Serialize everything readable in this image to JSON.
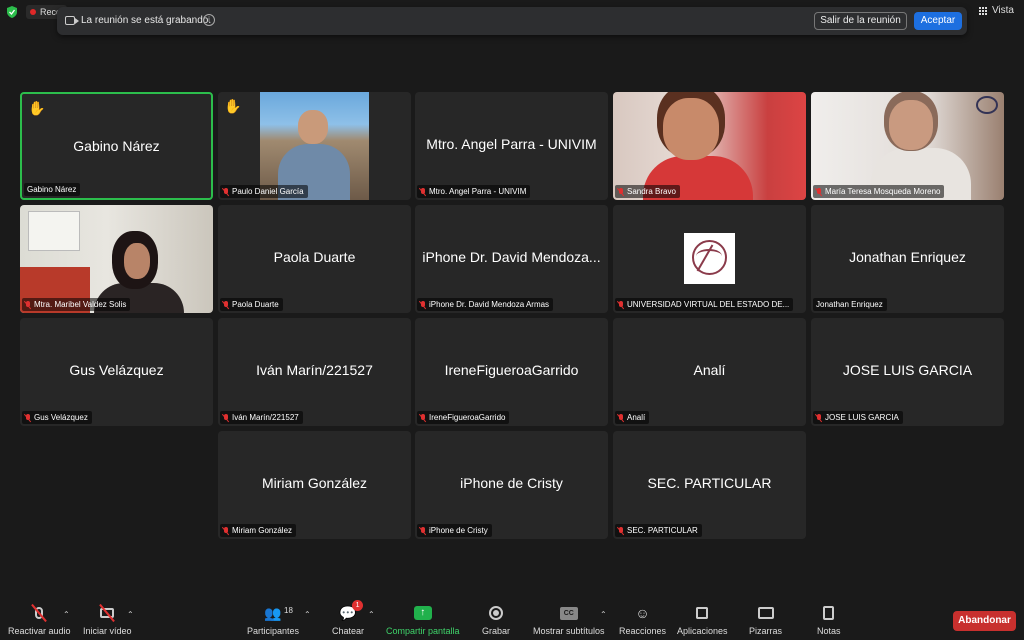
{
  "topbar": {
    "rec_label": "Reco",
    "view_label": "Vista"
  },
  "banner": {
    "message": "La reunión se está grabando.",
    "leave_label": "Salir de la reunión",
    "accept_label": "Aceptar"
  },
  "participants": [
    {
      "display": "Gabino Nárez",
      "label": "Gabino Nárez",
      "muted": false,
      "hand": true,
      "active": true
    },
    {
      "display": "",
      "label": "Paulo Daniel García",
      "muted": true,
      "hand": true,
      "video": "paulo"
    },
    {
      "display": "Mtro. Angel Parra - UNIVIM",
      "label": "Mtro. Angel Parra - UNIVIM",
      "muted": true
    },
    {
      "display": "",
      "label": "Sandra Bravo",
      "muted": true,
      "video": "sandra"
    },
    {
      "display": "",
      "label": "María Teresa Mosqueda Moreno",
      "muted": true,
      "video": "maria"
    },
    {
      "display": "",
      "label": "Mtra. Maribel Valdez Solis",
      "muted": true,
      "video": "maribel"
    },
    {
      "display": "Paola Duarte",
      "label": "Paola Duarte",
      "muted": true
    },
    {
      "display": "iPhone Dr. David Mendoza...",
      "label": "iPhone Dr. David Mendoza Armas",
      "muted": true
    },
    {
      "display": "",
      "label": "UNIVERSIDAD VIRTUAL DEL ESTADO DE...",
      "muted": true,
      "video": "univim-logo"
    },
    {
      "display": "Jonathan Enriquez",
      "label": "Jonathan Enriquez",
      "muted": false
    },
    {
      "display": "Gus Velázquez",
      "label": "Gus Velázquez",
      "muted": true
    },
    {
      "display": "Iván Marín/221527",
      "label": "Iván Marín/221527",
      "muted": true
    },
    {
      "display": "IreneFigueroaGarrido",
      "label": "IreneFigueroaGarrido",
      "muted": true
    },
    {
      "display": "Analí",
      "label": "Analí",
      "muted": true
    },
    {
      "display": "JOSE LUIS GARCIA",
      "label": "JOSE LUIS GARCIA",
      "muted": true
    },
    {
      "display": "Miriam González",
      "label": "Miriam González",
      "muted": true
    },
    {
      "display": "iPhone de Cristy",
      "label": "iPhone de Cristy",
      "muted": true
    },
    {
      "display": "SEC. PARTICULAR",
      "label": "SEC. PARTICULAR",
      "muted": true
    }
  ],
  "toolbar": {
    "unmute": "Reactivar audio",
    "start_video": "Iniciar vídeo",
    "participants": "Participantes",
    "participants_count": "18",
    "chat": "Chatear",
    "chat_badge": "1",
    "share": "Compartir pantalla",
    "record": "Grabar",
    "subtitles": "Mostrar subtítulos",
    "cc": "CC",
    "reactions": "Reacciones",
    "apps": "Aplicaciones",
    "whiteboards": "Pizarras",
    "notes": "Notas",
    "leave": "Abandonar"
  },
  "colors": {
    "active_speaker": "#2cbe4c",
    "leave_button": "#c8302e",
    "accept_button": "#1d6fe0",
    "share_green": "#21b14c",
    "muted_red": "#e03030"
  }
}
